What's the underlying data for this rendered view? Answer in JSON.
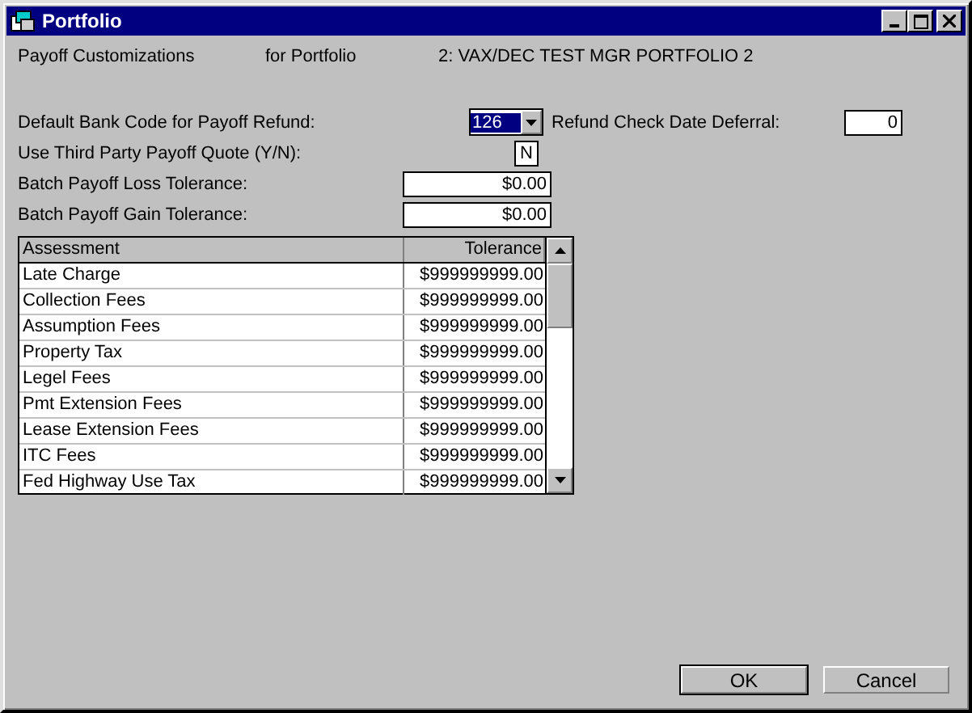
{
  "window": {
    "title": "Portfolio"
  },
  "header": {
    "title": "Payoff Customizations",
    "for_label": "for Portfolio",
    "portfolio": "2: VAX/DEC TEST MGR PORTFOLIO 2"
  },
  "bank_code": {
    "label": "Default Bank Code for Payoff Refund:",
    "value": "126",
    "text_selected": true
  },
  "deferral": {
    "label": "Refund Check Date Deferral:",
    "value": "0"
  },
  "third_party": {
    "label": "Use Third Party Payoff Quote (Y/N):",
    "value": "N"
  },
  "loss_tolerance": {
    "label": "Batch Payoff Loss Tolerance:",
    "value": "$0.00"
  },
  "gain_tolerance": {
    "label": "Batch Payoff Gain Tolerance:",
    "value": "$0.00"
  },
  "table": {
    "columns": [
      "Assessment",
      "Tolerance"
    ],
    "rows": [
      [
        "Late Charge",
        "$999999999.00"
      ],
      [
        "Collection Fees",
        "$999999999.00"
      ],
      [
        "Assumption Fees",
        "$999999999.00"
      ],
      [
        "Property Tax",
        "$999999999.00"
      ],
      [
        "Legel Fees",
        "$999999999.00"
      ],
      [
        "Pmt Extension Fees",
        "$999999999.00"
      ],
      [
        "Lease Extension Fees",
        "$999999999.00"
      ],
      [
        "ITC Fees",
        "$999999999.00"
      ],
      [
        "Fed Highway Use Tax",
        "$999999999.00"
      ]
    ]
  },
  "buttons": [
    {
      "label": "OK",
      "default": true
    },
    {
      "label": "Cancel",
      "default": false
    }
  ]
}
